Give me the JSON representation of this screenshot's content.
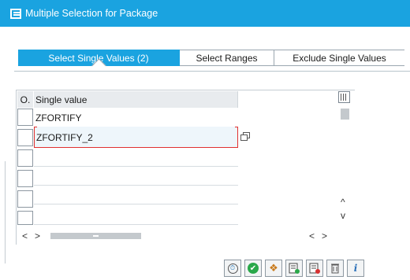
{
  "window": {
    "title": "Multiple Selection for Package"
  },
  "tabs": [
    {
      "label": "Select Single Values (2)",
      "active": true
    },
    {
      "label": "Select Ranges",
      "active": false
    },
    {
      "label": "Exclude Single Values",
      "active": false
    }
  ],
  "table": {
    "headers": {
      "option": "O.",
      "value": "Single value"
    },
    "rows": [
      {
        "value": "ZFORTIFY"
      },
      {
        "value": "ZFORTIFY_2"
      },
      {
        "value": ""
      },
      {
        "value": ""
      },
      {
        "value": ""
      },
      {
        "value": ""
      }
    ]
  },
  "scroll_glyphs": {
    "left": "<",
    "right": ">",
    "up": "^",
    "down": "v"
  },
  "toolbar": {
    "buttons": [
      "execute-icon",
      "confirm-icon",
      "multiple-selection-icon",
      "insert-row-icon",
      "delete-row-icon",
      "delete-all-icon",
      "info-icon"
    ]
  },
  "colors": {
    "titlebar": "#1aa3e0",
    "active_tab": "#1aa3e0",
    "focus_border": "#e03030",
    "ok": "#2aa84a"
  }
}
